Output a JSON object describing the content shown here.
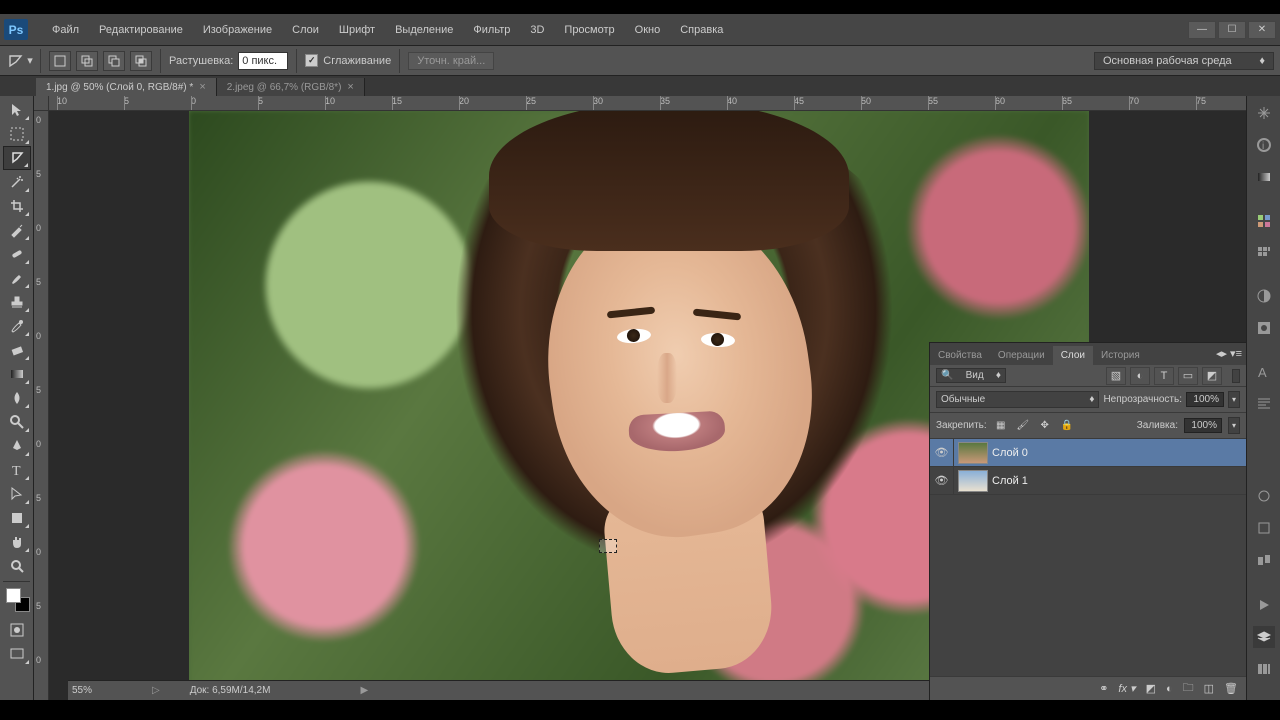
{
  "menu": {
    "file": "Файл",
    "edit": "Редактирование",
    "image": "Изображение",
    "layer": "Слои",
    "type": "Шрифт",
    "select": "Выделение",
    "filter": "Фильтр",
    "3d": "3D",
    "view": "Просмотр",
    "window": "Окно",
    "help": "Справка"
  },
  "opt": {
    "feather_label": "Растушевка:",
    "feather_value": "0 пикс.",
    "antialias": "Сглаживание",
    "refine": "Уточн. край...",
    "workspace": "Основная рабочая среда"
  },
  "tabs": {
    "t1": "1.jpg @ 50% (Слой 0, RGB/8#) *",
    "t2": "2.jpeg @ 66,7% (RGB/8*)"
  },
  "ruler": {
    "h": [
      "10",
      "5",
      "0",
      "5",
      "10",
      "15",
      "20",
      "25",
      "30",
      "35",
      "40",
      "45",
      "50",
      "55",
      "60",
      "65",
      "70",
      "75"
    ],
    "v": [
      "0",
      "5",
      "0",
      "5",
      "0",
      "5",
      "0",
      "5",
      "0",
      "5",
      "0"
    ]
  },
  "panel": {
    "tabs": {
      "props": "Свойства",
      "actions": "Операции",
      "layers": "Слои",
      "history": "История"
    },
    "filter_kind": "Вид",
    "blend": "Обычные",
    "opacity_label": "Непрозрачность:",
    "opacity": "100%",
    "lock_label": "Закрепить:",
    "fill_label": "Заливка:",
    "fill": "100%",
    "layers": [
      {
        "name": "Слой 0"
      },
      {
        "name": "Слой 1"
      }
    ]
  },
  "status": {
    "zoom": "55%",
    "doc": "Док: 6,59M/14,2M"
  }
}
